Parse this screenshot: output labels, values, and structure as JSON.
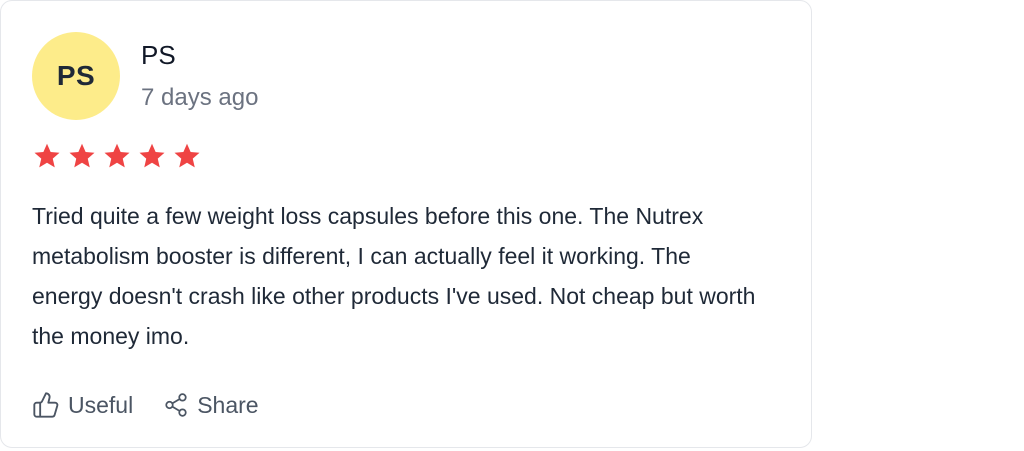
{
  "review": {
    "avatar_initials": "PS",
    "avatar_color": "#fdec8a",
    "author": "PS",
    "time": "7 days ago",
    "rating": 5,
    "rating_max": 5,
    "star_color": "#ef4444",
    "text": "Tried quite a few weight loss capsules before this one. The Nutrex metabolism booster is different, I can actually feel it working. The energy doesn't crash like other products I've used. Not cheap but worth the money imo.",
    "actions": {
      "useful_label": "Useful",
      "useful_icon": "thumbs-up-icon",
      "share_label": "Share",
      "share_icon": "share-icon"
    }
  }
}
